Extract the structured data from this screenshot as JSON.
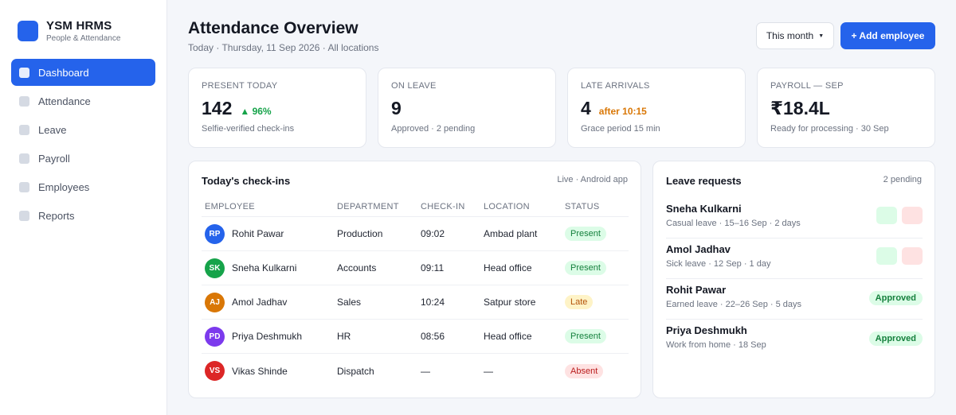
{
  "brand": {
    "name": "YSM HRMS",
    "subtitle": "People & Attendance"
  },
  "nav": {
    "items": [
      {
        "label": "Dashboard",
        "active": true
      },
      {
        "label": "Attendance"
      },
      {
        "label": "Leave"
      },
      {
        "label": "Payroll"
      },
      {
        "label": "Employees"
      },
      {
        "label": "Reports"
      }
    ]
  },
  "header": {
    "title": "Attendance Overview",
    "subtitle": "Today · Thursday, 11 Sep 2026 · All locations",
    "period": "This month",
    "add_label": "+ Add employee"
  },
  "stats": [
    {
      "label": "PRESENT TODAY",
      "value": "142",
      "delta": "▲ 96%",
      "note": "Selfie-verified check-ins"
    },
    {
      "label": "ON LEAVE",
      "value": "9",
      "delta": "",
      "note": "Approved · 2 pending"
    },
    {
      "label": "LATE ARRIVALS",
      "value": "4",
      "delta": "after 10:15",
      "note": "Grace period 15 min"
    },
    {
      "label": "PAYROLL — SEP",
      "value": "₹18.4L",
      "delta": "",
      "note": "Ready for processing · 30 Sep"
    }
  ],
  "checkins": {
    "title": "Today's check-ins",
    "meta": "Live · Android app",
    "columns": [
      "EMPLOYEE",
      "DEPARTMENT",
      "CHECK-IN",
      "LOCATION",
      "STATUS"
    ],
    "rows": [
      {
        "initials": "RP",
        "name": "Rohit Pawar",
        "dept": "Production",
        "time": "09:02",
        "location": "Ambad plant",
        "status": "Present",
        "avatar_color": "#2563eb"
      },
      {
        "initials": "SK",
        "name": "Sneha Kulkarni",
        "dept": "Accounts",
        "time": "09:11",
        "location": "Head office",
        "status": "Present",
        "avatar_color": "#16a34a"
      },
      {
        "initials": "AJ",
        "name": "Amol Jadhav",
        "dept": "Sales",
        "time": "10:24",
        "location": "Satpur store",
        "status": "Late",
        "avatar_color": "#d97706"
      },
      {
        "initials": "PD",
        "name": "Priya Deshmukh",
        "dept": "HR",
        "time": "08:56",
        "location": "Head office",
        "status": "Present",
        "avatar_color": "#7c3aed"
      },
      {
        "initials": "VS",
        "name": "Vikas Shinde",
        "dept": "Dispatch",
        "time": "—",
        "location": "—",
        "status": "Absent",
        "avatar_color": "#dc2626"
      }
    ]
  },
  "leaves": {
    "title": "Leave requests",
    "meta": "2 pending",
    "items": [
      {
        "name": "Sneha Kulkarni",
        "detail": "Casual leave · 15–16 Sep · 2 days",
        "status": ""
      },
      {
        "name": "Amol Jadhav",
        "detail": "Sick leave · 12 Sep · 1 day",
        "status": ""
      },
      {
        "name": "Rohit Pawar",
        "detail": "Earned leave · 22–26 Sep · 5 days",
        "status": "Approved"
      },
      {
        "name": "Priya Deshmukh",
        "detail": "Work from home · 18 Sep",
        "status": "Approved"
      }
    ]
  },
  "colors": {
    "accent": "#2563eb",
    "success": "#16a34a",
    "warning": "#d97706",
    "danger": "#dc2626"
  }
}
